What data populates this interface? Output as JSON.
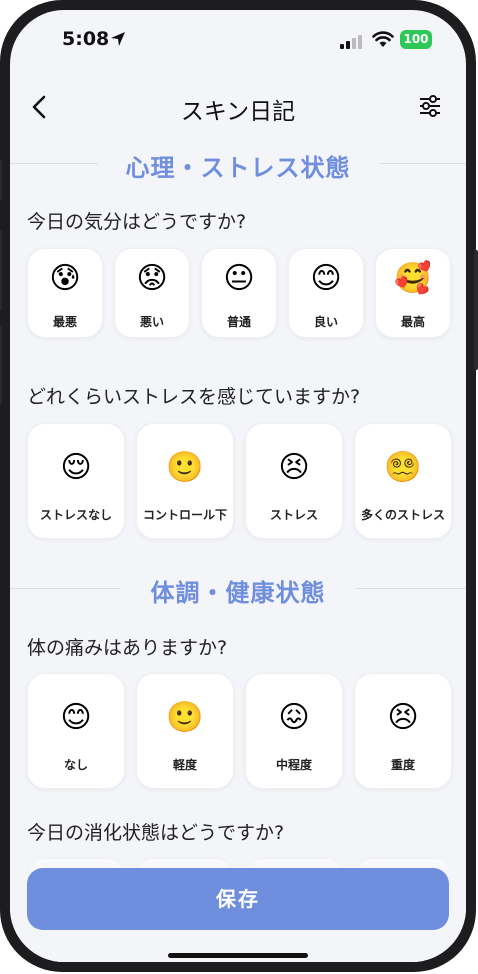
{
  "status_bar": {
    "time": "5:08",
    "battery": "100"
  },
  "nav": {
    "title": "スキン日記"
  },
  "sections": {
    "mental": {
      "title": "心理・ストレス状態",
      "mood_question": "今日の気分はどうですか?",
      "mood_options": [
        {
          "emoji": "😰",
          "label": "最悪"
        },
        {
          "emoji": "😟",
          "label": "悪い"
        },
        {
          "emoji": "😐",
          "label": "普通"
        },
        {
          "emoji": "😊",
          "label": "良い"
        },
        {
          "emoji": "🥰",
          "label": "最高"
        }
      ],
      "stress_question": "どれくらいストレスを感じていますか?",
      "stress_options": [
        {
          "emoji": "😌",
          "label": "ストレスなし"
        },
        {
          "emoji": "🙂",
          "label": "コントロール下"
        },
        {
          "emoji": "😣",
          "label": "ストレス"
        },
        {
          "emoji": "😵‍💫",
          "label": "多くのストレス"
        }
      ]
    },
    "physical": {
      "title": "体調・健康状態",
      "pain_question": "体の痛みはありますか?",
      "pain_options": [
        {
          "emoji": "😊",
          "label": "なし"
        },
        {
          "emoji": "🙂",
          "label": "軽度"
        },
        {
          "emoji": "😖",
          "label": "中程度"
        },
        {
          "emoji": "😣",
          "label": "重度"
        }
      ],
      "digestion_question": "今日の消化状態はどうですか?"
    }
  },
  "save_button": {
    "label": "保存"
  }
}
